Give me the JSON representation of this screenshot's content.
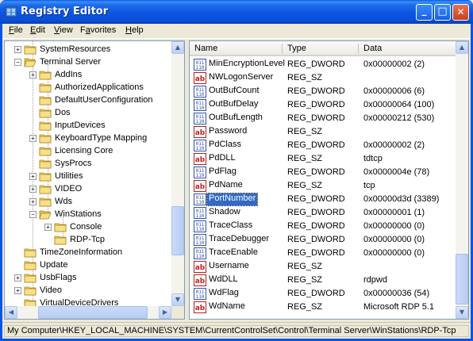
{
  "window": {
    "title": "Registry Editor",
    "minimize": "_",
    "maximize": "□",
    "close": "✕"
  },
  "menu": {
    "file": "File",
    "edit": "Edit",
    "view": "View",
    "favorites": "Favorites",
    "help": "Help",
    "file_key": "F",
    "edit_key": "E",
    "view_key": "V",
    "favorites_key": "a",
    "help_key": "H"
  },
  "tree": {
    "items": [
      {
        "label": "SystemResources",
        "expander": "+"
      },
      {
        "label": "Terminal Server",
        "expander": "−"
      },
      {
        "label": "AddIns",
        "expander": "+"
      },
      {
        "label": "AuthorizedApplications",
        "expander": ""
      },
      {
        "label": "DefaultUserConfiguration",
        "expander": ""
      },
      {
        "label": "Dos",
        "expander": ""
      },
      {
        "label": "InputDevices",
        "expander": ""
      },
      {
        "label": "KeyboardType Mapping",
        "expander": "+"
      },
      {
        "label": "Licensing Core",
        "expander": ""
      },
      {
        "label": "SysProcs",
        "expander": ""
      },
      {
        "label": "Utilities",
        "expander": "+"
      },
      {
        "label": "VIDEO",
        "expander": "+"
      },
      {
        "label": "Wds",
        "expander": "+"
      },
      {
        "label": "WinStations",
        "expander": "−"
      },
      {
        "label": "Console",
        "expander": "+"
      },
      {
        "label": "RDP-Tcp",
        "expander": ""
      },
      {
        "label": "TimeZoneInformation",
        "expander": ""
      },
      {
        "label": "Update",
        "expander": ""
      },
      {
        "label": "UsbFlags",
        "expander": "+"
      },
      {
        "label": "Video",
        "expander": "+"
      },
      {
        "label": "VirtualDeviceDrivers",
        "expander": ""
      }
    ]
  },
  "list": {
    "headers": {
      "name": "Name",
      "type": "Type",
      "data": "Data"
    },
    "rows": [
      {
        "name": "MinEncryptionLevel",
        "type": "REG_DWORD",
        "data": "0x00000002 (2)",
        "icon": "dword-icon"
      },
      {
        "name": "NWLogonServer",
        "type": "REG_SZ",
        "data": "",
        "icon": "string-icon"
      },
      {
        "name": "OutBufCount",
        "type": "REG_DWORD",
        "data": "0x00000006 (6)",
        "icon": "dword-icon"
      },
      {
        "name": "OutBufDelay",
        "type": "REG_DWORD",
        "data": "0x00000064 (100)",
        "icon": "dword-icon"
      },
      {
        "name": "OutBufLength",
        "type": "REG_DWORD",
        "data": "0x00000212 (530)",
        "icon": "dword-icon"
      },
      {
        "name": "Password",
        "type": "REG_SZ",
        "data": "",
        "icon": "string-icon"
      },
      {
        "name": "PdClass",
        "type": "REG_DWORD",
        "data": "0x00000002 (2)",
        "icon": "dword-icon"
      },
      {
        "name": "PdDLL",
        "type": "REG_SZ",
        "data": "tdtcp",
        "icon": "string-icon"
      },
      {
        "name": "PdFlag",
        "type": "REG_DWORD",
        "data": "0x0000004e (78)",
        "icon": "dword-icon"
      },
      {
        "name": "PdName",
        "type": "REG_SZ",
        "data": "tcp",
        "icon": "string-icon"
      },
      {
        "name": "PortNumber",
        "type": "REG_DWORD",
        "data": "0x00000d3d (3389)",
        "icon": "dword-icon",
        "selected": true
      },
      {
        "name": "Shadow",
        "type": "REG_DWORD",
        "data": "0x00000001 (1)",
        "icon": "dword-icon"
      },
      {
        "name": "TraceClass",
        "type": "REG_DWORD",
        "data": "0x00000000 (0)",
        "icon": "dword-icon"
      },
      {
        "name": "TraceDebugger",
        "type": "REG_DWORD",
        "data": "0x00000000 (0)",
        "icon": "dword-icon"
      },
      {
        "name": "TraceEnable",
        "type": "REG_DWORD",
        "data": "0x00000000 (0)",
        "icon": "dword-icon"
      },
      {
        "name": "Username",
        "type": "REG_SZ",
        "data": "",
        "icon": "string-icon"
      },
      {
        "name": "WdDLL",
        "type": "REG_SZ",
        "data": "rdpwd",
        "icon": "string-icon"
      },
      {
        "name": "WdFlag",
        "type": "REG_DWORD",
        "data": "0x00000036 (54)",
        "icon": "dword-icon"
      },
      {
        "name": "WdName",
        "type": "REG_SZ",
        "data": "Microsoft RDP 5.1",
        "icon": "string-icon"
      }
    ]
  },
  "status": {
    "path": "My Computer\\HKEY_LOCAL_MACHINE\\SYSTEM\\CurrentControlSet\\Control\\Terminal Server\\WinStations\\RDP-Tcp"
  },
  "colors": {
    "titlebar": "#0a55e3",
    "selection": "#316ac5",
    "folder": "#f0d060",
    "window_bg": "#ece9d8"
  }
}
